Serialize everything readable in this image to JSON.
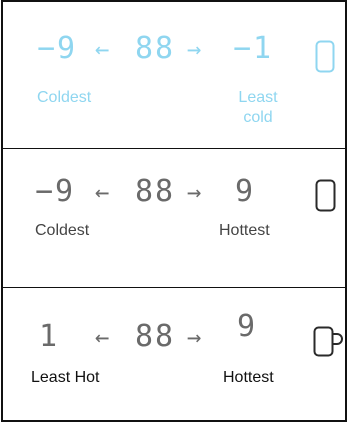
{
  "rows": [
    {
      "left_value": "−9",
      "arrow_left": "←",
      "center_value": "88",
      "arrow_right": "→",
      "right_value": "−1",
      "left_label": "Coldest",
      "right_label_line1": "Least",
      "right_label_line2": "cold",
      "icon": "glass-icon",
      "color": "#8fd6f0"
    },
    {
      "left_value": "−9",
      "arrow_left": "←",
      "center_value": "88",
      "arrow_right": "→",
      "right_value": "9",
      "left_label": "Coldest",
      "right_label": "Hottest",
      "icon": "glass-icon",
      "color": "#6a6a6a"
    },
    {
      "left_value": "1",
      "arrow_left": "←",
      "center_value": "88",
      "arrow_right": "→",
      "right_value": "9",
      "left_label": "Least Hot",
      "right_label": "Hottest",
      "icon": "mug-icon",
      "color": "#6a6a6a"
    }
  ]
}
